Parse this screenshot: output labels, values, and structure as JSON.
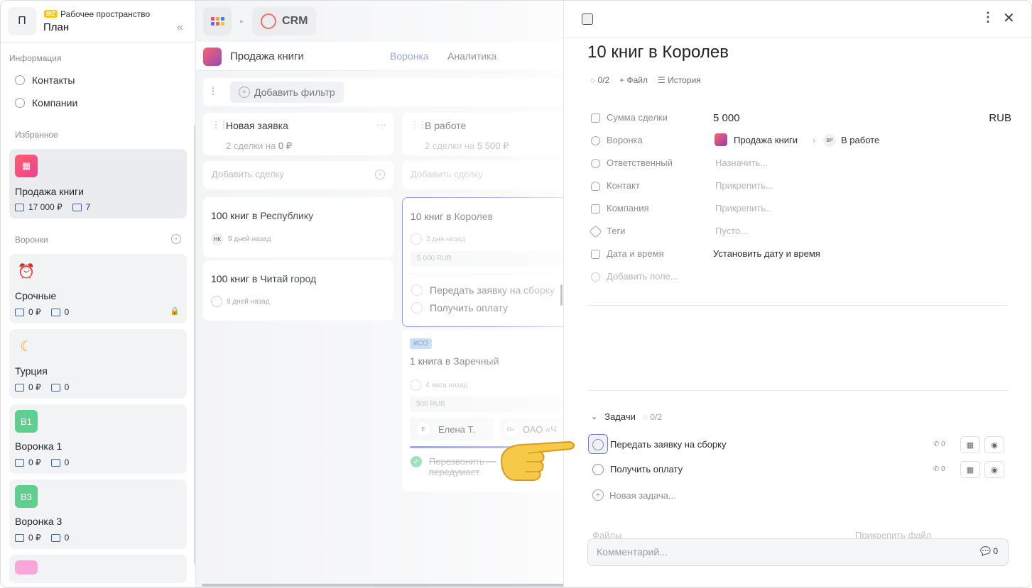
{
  "sidebar": {
    "workspace": {
      "avatar": "П",
      "badge": "BIZ",
      "subtitle": "Рабочее пространство",
      "title": "План"
    },
    "info_label": "Информация",
    "nav": [
      {
        "label": "Контакты",
        "icon": "users-icon"
      },
      {
        "label": "Компании",
        "icon": "globe-icon"
      }
    ],
    "favorites_label": "Избранное",
    "favorite": {
      "name": "Продажа книги",
      "sum": "17 000 ₽",
      "count": "7"
    },
    "pipelines_label": "Воронки",
    "pipelines": [
      {
        "name": "Срочные",
        "icon": "alarm-clock-icon",
        "sum": "0 ₽",
        "count": "0",
        "locked": true
      },
      {
        "name": "Турция",
        "icon": "crescent-moon-icon",
        "sum": "0 ₽",
        "count": "0"
      },
      {
        "name": "Воронка 1",
        "badge": "В1",
        "badge_color": "#5fcf8f",
        "sum": "0 ₽",
        "count": "0"
      },
      {
        "name": "Воронка 3",
        "badge": "В3",
        "badge_color": "#5fcf8f",
        "sum": "0 ₽",
        "count": "0"
      }
    ]
  },
  "topbar": {
    "app": "CRM"
  },
  "pipeline": {
    "title": "Продажа книги",
    "tabs": [
      "Воронка",
      "Аналитика"
    ],
    "add_filter": "Добавить фильтр",
    "add_deal": "Добавить сделку",
    "columns": [
      {
        "title": "Новая заявка",
        "summary": "2 сделки на ",
        "summary_value": "0 ₽"
      },
      {
        "title": "В работе",
        "summary": "2 сделки на ",
        "summary_value": "5 500 ₽"
      }
    ],
    "deals_new": [
      {
        "title": "100 книг в Республику",
        "user": "НК",
        "time": "9 дней назад"
      },
      {
        "title": "100 книг в Читай город",
        "time": "9 дней назад"
      }
    ],
    "deal_active": {
      "title": "10 книг в Королев",
      "time": "2 дня назад",
      "price": "5 000 RUB",
      "tasks": [
        "Передать заявку на сборку",
        "Получить оплату"
      ]
    },
    "deal_third": {
      "tag": "#CO",
      "title": "1 книга в Заречный",
      "time": "4 часа назад",
      "price": "500 RUB",
      "contact": "Елена Т.",
      "contact_initial": "Е",
      "company": "ОАО «Ч",
      "company_initial": "О«",
      "done_task": "Перезвонить — передумает"
    }
  },
  "panel": {
    "title": "10 книг в Королев",
    "progress": "0/2",
    "file": "Файл",
    "history": "История",
    "fields": [
      {
        "label": "Сумма сделки",
        "value": "5 000",
        "currency": "RUB"
      },
      {
        "label": "Воронка",
        "pipeline": "Продажа книги",
        "stage_badge": "ВР",
        "stage": "В работе"
      },
      {
        "label": "Ответственный",
        "placeholder": "Назначить..."
      },
      {
        "label": "Контакт",
        "placeholder": "Прикрепить..."
      },
      {
        "label": "Компания",
        "placeholder": "Прикрепить.."
      },
      {
        "label": "Теги",
        "placeholder": "Пусто..."
      },
      {
        "label": "Дата и время",
        "value": "Установить дату и время"
      }
    ],
    "add_field": "Добавить поле...",
    "tasks_label": "Задачи",
    "tasks_progress": "0/2",
    "tasks": [
      {
        "label": "Передать заявку на сборку",
        "count": "0"
      },
      {
        "label": "Получить оплату",
        "count": "0"
      }
    ],
    "new_task": "Новая задача...",
    "files_label": "Файлы",
    "attach_file": "Прикрепить файл",
    "comment_placeholder": "Комментарий...",
    "comment_count": "0"
  },
  "colors": {
    "accent": "#5b6ee1",
    "active_border": "#4a63d8",
    "brand_pink": "#ff5f6d"
  }
}
